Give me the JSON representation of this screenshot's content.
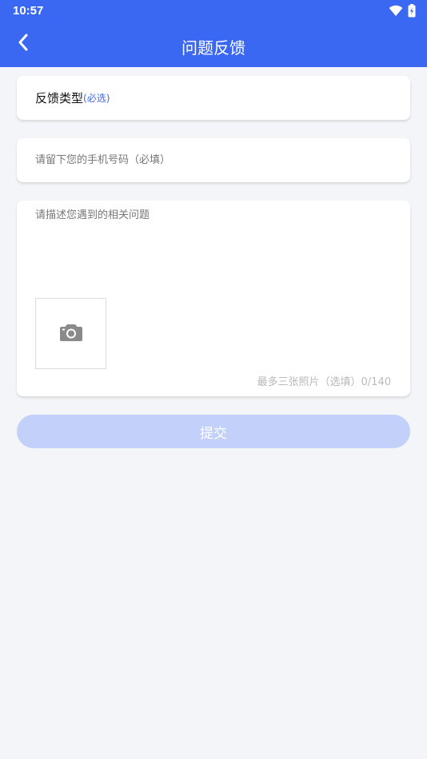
{
  "status_bar": {
    "time": "10:57"
  },
  "header": {
    "title": "问题反馈",
    "back_icon": "chevron-left-icon"
  },
  "feedback_type": {
    "label": "反馈类型",
    "note": "(必选)"
  },
  "phone": {
    "placeholder": "请留下您的手机号码（必填）",
    "value": ""
  },
  "description": {
    "placeholder": "请描述您遇到的相关问题",
    "value": "",
    "photo_icon": "camera-icon",
    "hint": "最多三张照片（选填）0/140"
  },
  "submit": {
    "label": "提交"
  },
  "colors": {
    "primary": "#3a68f2",
    "button_disabled": "#c2d0fa",
    "background": "#f4f5f8"
  }
}
